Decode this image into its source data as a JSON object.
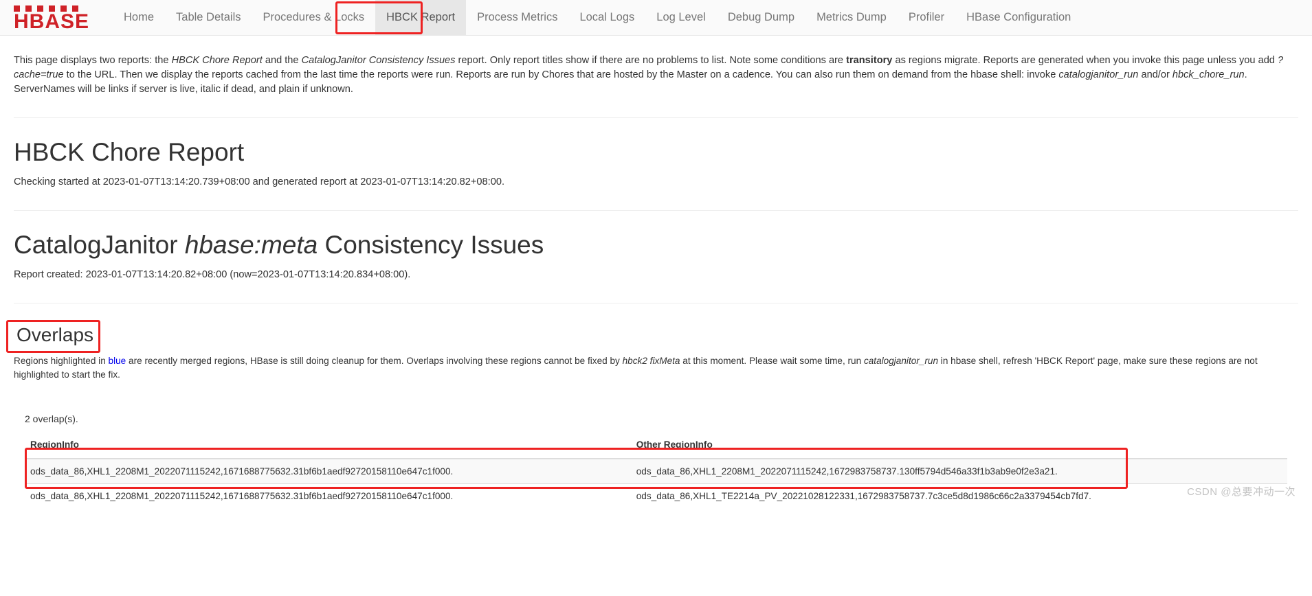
{
  "nav": {
    "brand": {
      "top_text": "A P A C H E",
      "main_text": "HBASE",
      "color": "#cf2127"
    },
    "items": [
      {
        "label": "Home",
        "active": false
      },
      {
        "label": "Table Details",
        "active": false
      },
      {
        "label": "Procedures & Locks",
        "active": false
      },
      {
        "label": "HBCK Report",
        "active": true
      },
      {
        "label": "Process Metrics",
        "active": false
      },
      {
        "label": "Local Logs",
        "active": false
      },
      {
        "label": "Log Level",
        "active": false
      },
      {
        "label": "Debug Dump",
        "active": false
      },
      {
        "label": "Metrics Dump",
        "active": false
      },
      {
        "label": "Profiler",
        "active": false
      },
      {
        "label": "HBase Configuration",
        "active": false
      }
    ]
  },
  "intro": {
    "p1": "This page displays two reports: the ",
    "em1": "HBCK Chore Report",
    "p2": " and the ",
    "em2": "CatalogJanitor Consistency Issues",
    "p3": " report. Only report titles show if there are no problems to list. Note some conditions are ",
    "bold1": "transitory",
    "p4": " as regions migrate. Reports are generated when you invoke this page unless you add ",
    "em3": "?cache=true",
    "p5": " to the URL. Then we display the reports cached from the last time the reports were run. Reports are run by Chores that are hosted by the Master on a cadence. You can also run them on demand from the hbase shell: invoke ",
    "em4": "catalogjanitor_run",
    "p6": " and/or ",
    "em5": "hbck_chore_run",
    "p7": ". ServerNames will be links if server is live, italic if dead, and plain if unknown."
  },
  "hbck_chore": {
    "title": "HBCK Chore Report",
    "subtitle": "Checking started at 2023-01-07T13:14:20.739+08:00 and generated report at 2023-01-07T13:14:20.82+08:00."
  },
  "catalog_janitor": {
    "title_part1": "CatalogJanitor ",
    "title_em": "hbase:meta",
    "title_part2": " Consistency Issues",
    "subtitle": "Report created: 2023-01-07T13:14:20.82+08:00 (now=2023-01-07T13:14:20.834+08:00)."
  },
  "overlaps": {
    "heading": "Overlaps",
    "note_p1": "Regions highlighted in ",
    "note_link": "blue",
    "note_p2": " are recently merged regions, HBase is still doing cleanup for them. Overlaps involving these regions cannot be fixed by ",
    "note_em1": "hbck2 fixMeta",
    "note_p3": " at this moment. Please wait some time, run ",
    "note_em2": "catalogjanitor_run",
    "note_p4": " in hbase shell, refresh 'HBCK Report' page, make sure these regions are not highlighted to start the fix.",
    "count_text": "2 overlap(s).",
    "columns": [
      "RegionInfo",
      "Other RegionInfo"
    ],
    "rows": [
      {
        "region_info": "ods_data_86,XHL1_2208M1_2022071115242,1671688775632.31bf6b1aedf92720158110e647c1f000.",
        "other_region_info": "ods_data_86,XHL1_2208M1_2022071115242,1672983758737.130ff5794d546a33f1b3ab9e0f2e3a21."
      },
      {
        "region_info": "ods_data_86,XHL1_2208M1_2022071115242,1671688775632.31bf6b1aedf92720158110e647c1f000.",
        "other_region_info": "ods_data_86,XHL1_TE2214a_PV_20221028122331,1672983758737.7c3ce5d8d1986c66c2a3379454cb7fd7."
      }
    ]
  },
  "watermark": "CSDN @总要冲动一次",
  "annotation_color": "#ee2222"
}
